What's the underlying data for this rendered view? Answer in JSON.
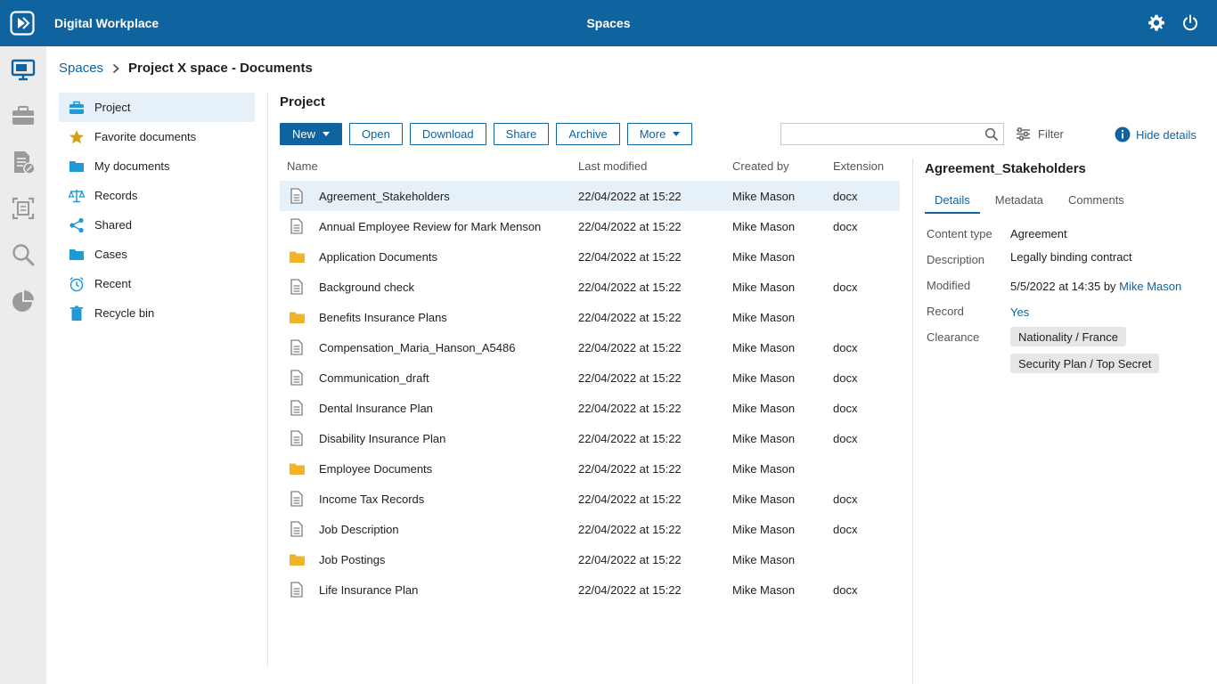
{
  "app": {
    "title": "Digital Workplace",
    "section": "Spaces"
  },
  "colors": {
    "brand": "#0f64a0",
    "folder": "#f0b429",
    "selected": "#e6f0f8"
  },
  "breadcrumb": {
    "root": "Spaces",
    "current": "Project X space - Documents"
  },
  "tree": [
    {
      "label": "Project",
      "icon": "briefcase-icon"
    },
    {
      "label": "Favorite documents",
      "icon": "star-icon"
    },
    {
      "label": "My documents",
      "icon": "folder-icon"
    },
    {
      "label": "Records",
      "icon": "scales-icon"
    },
    {
      "label": "Shared",
      "icon": "share-icon"
    },
    {
      "label": "Cases",
      "icon": "folder-icon"
    },
    {
      "label": "Recent",
      "icon": "clock-icon"
    },
    {
      "label": "Recycle bin",
      "icon": "trash-icon"
    }
  ],
  "main": {
    "title": "Project",
    "toolbar": {
      "new": "New",
      "open": "Open",
      "download": "Download",
      "share": "Share",
      "archive": "Archive",
      "more": "More"
    },
    "search": {
      "placeholder": ""
    },
    "filter": "Filter",
    "hide_details": "Hide details",
    "columns": {
      "name": "Name",
      "modified": "Last modified",
      "by": "Created by",
      "ext": "Extension"
    },
    "rows": [
      {
        "name": "Agreement_Stakeholders",
        "modified": "22/04/2022 at 15:22",
        "by": "Mike Mason",
        "ext": "docx"
      },
      {
        "name": "Annual Employee Review for Mark Menson",
        "modified": "22/04/2022 at 15:22",
        "by": "Mike Mason",
        "ext": "docx"
      },
      {
        "name": "Application Documents",
        "modified": "22/04/2022 at 15:22",
        "by": "Mike Mason",
        "ext": ""
      },
      {
        "name": "Background check",
        "modified": "22/04/2022 at 15:22",
        "by": "Mike Mason",
        "ext": "docx"
      },
      {
        "name": "Benefits Insurance Plans",
        "modified": "22/04/2022 at 15:22",
        "by": "Mike Mason",
        "ext": ""
      },
      {
        "name": "Compensation_Maria_Hanson_A5486",
        "modified": "22/04/2022 at 15:22",
        "by": "Mike Mason",
        "ext": "docx"
      },
      {
        "name": "Communication_draft",
        "modified": "22/04/2022 at 15:22",
        "by": "Mike Mason",
        "ext": "docx"
      },
      {
        "name": "Dental Insurance Plan",
        "modified": "22/04/2022 at 15:22",
        "by": "Mike Mason",
        "ext": "docx"
      },
      {
        "name": "Disability Insurance Plan",
        "modified": "22/04/2022 at 15:22",
        "by": "Mike Mason",
        "ext": "docx"
      },
      {
        "name": "Employee Documents",
        "modified": "22/04/2022 at 15:22",
        "by": "Mike Mason",
        "ext": ""
      },
      {
        "name": "Income Tax Records",
        "modified": "22/04/2022 at 15:22",
        "by": "Mike Mason",
        "ext": "docx"
      },
      {
        "name": "Job Description",
        "modified": "22/04/2022 at 15:22",
        "by": "Mike Mason",
        "ext": "docx"
      },
      {
        "name": "Job Postings",
        "modified": "22/04/2022 at 15:22",
        "by": "Mike Mason",
        "ext": ""
      },
      {
        "name": "Life Insurance Plan",
        "modified": "22/04/2022 at 15:22",
        "by": "Mike Mason",
        "ext": "docx"
      }
    ]
  },
  "details": {
    "title": "Agreement_Stakeholders",
    "tabs": [
      "Details",
      "Metadata",
      "Comments"
    ],
    "labels": {
      "content_type": "Content type",
      "description": "Description",
      "modified": "Modified",
      "record": "Record",
      "clearance": "Clearance"
    },
    "content_type": "Agreement",
    "description": "Legally binding contract",
    "modified_date": "5/5/2022 at 14:35 by",
    "modified_by": "Mike Mason",
    "record": "Yes",
    "clearance": [
      "Nationality / France",
      "Security Plan / Top Secret"
    ]
  }
}
